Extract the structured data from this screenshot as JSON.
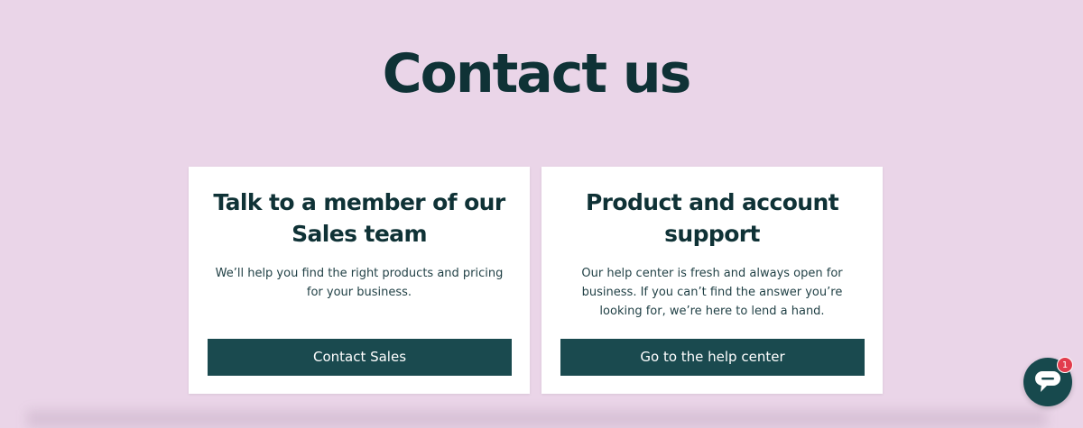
{
  "page": {
    "title": "Contact us",
    "background_color": "#ead5e8"
  },
  "cards": [
    {
      "title": "Talk to a member of our Sales team",
      "description": "We’ll help you find the right products and pricing for your business.",
      "button_label": "Contact Sales"
    },
    {
      "title": "Product and account support",
      "description": "Our help center is fresh and always open for business. If you can’t find the answer you’re looking for, we’re here to lend a hand.",
      "button_label": "Go to the help center"
    }
  ],
  "chat_widget": {
    "icon": "chat-bubble-icon",
    "badge_count": "1",
    "color": "#17494d",
    "badge_color": "#e23c4d"
  },
  "colors": {
    "heading": "#0f3236",
    "button": "#1a4a4f"
  }
}
